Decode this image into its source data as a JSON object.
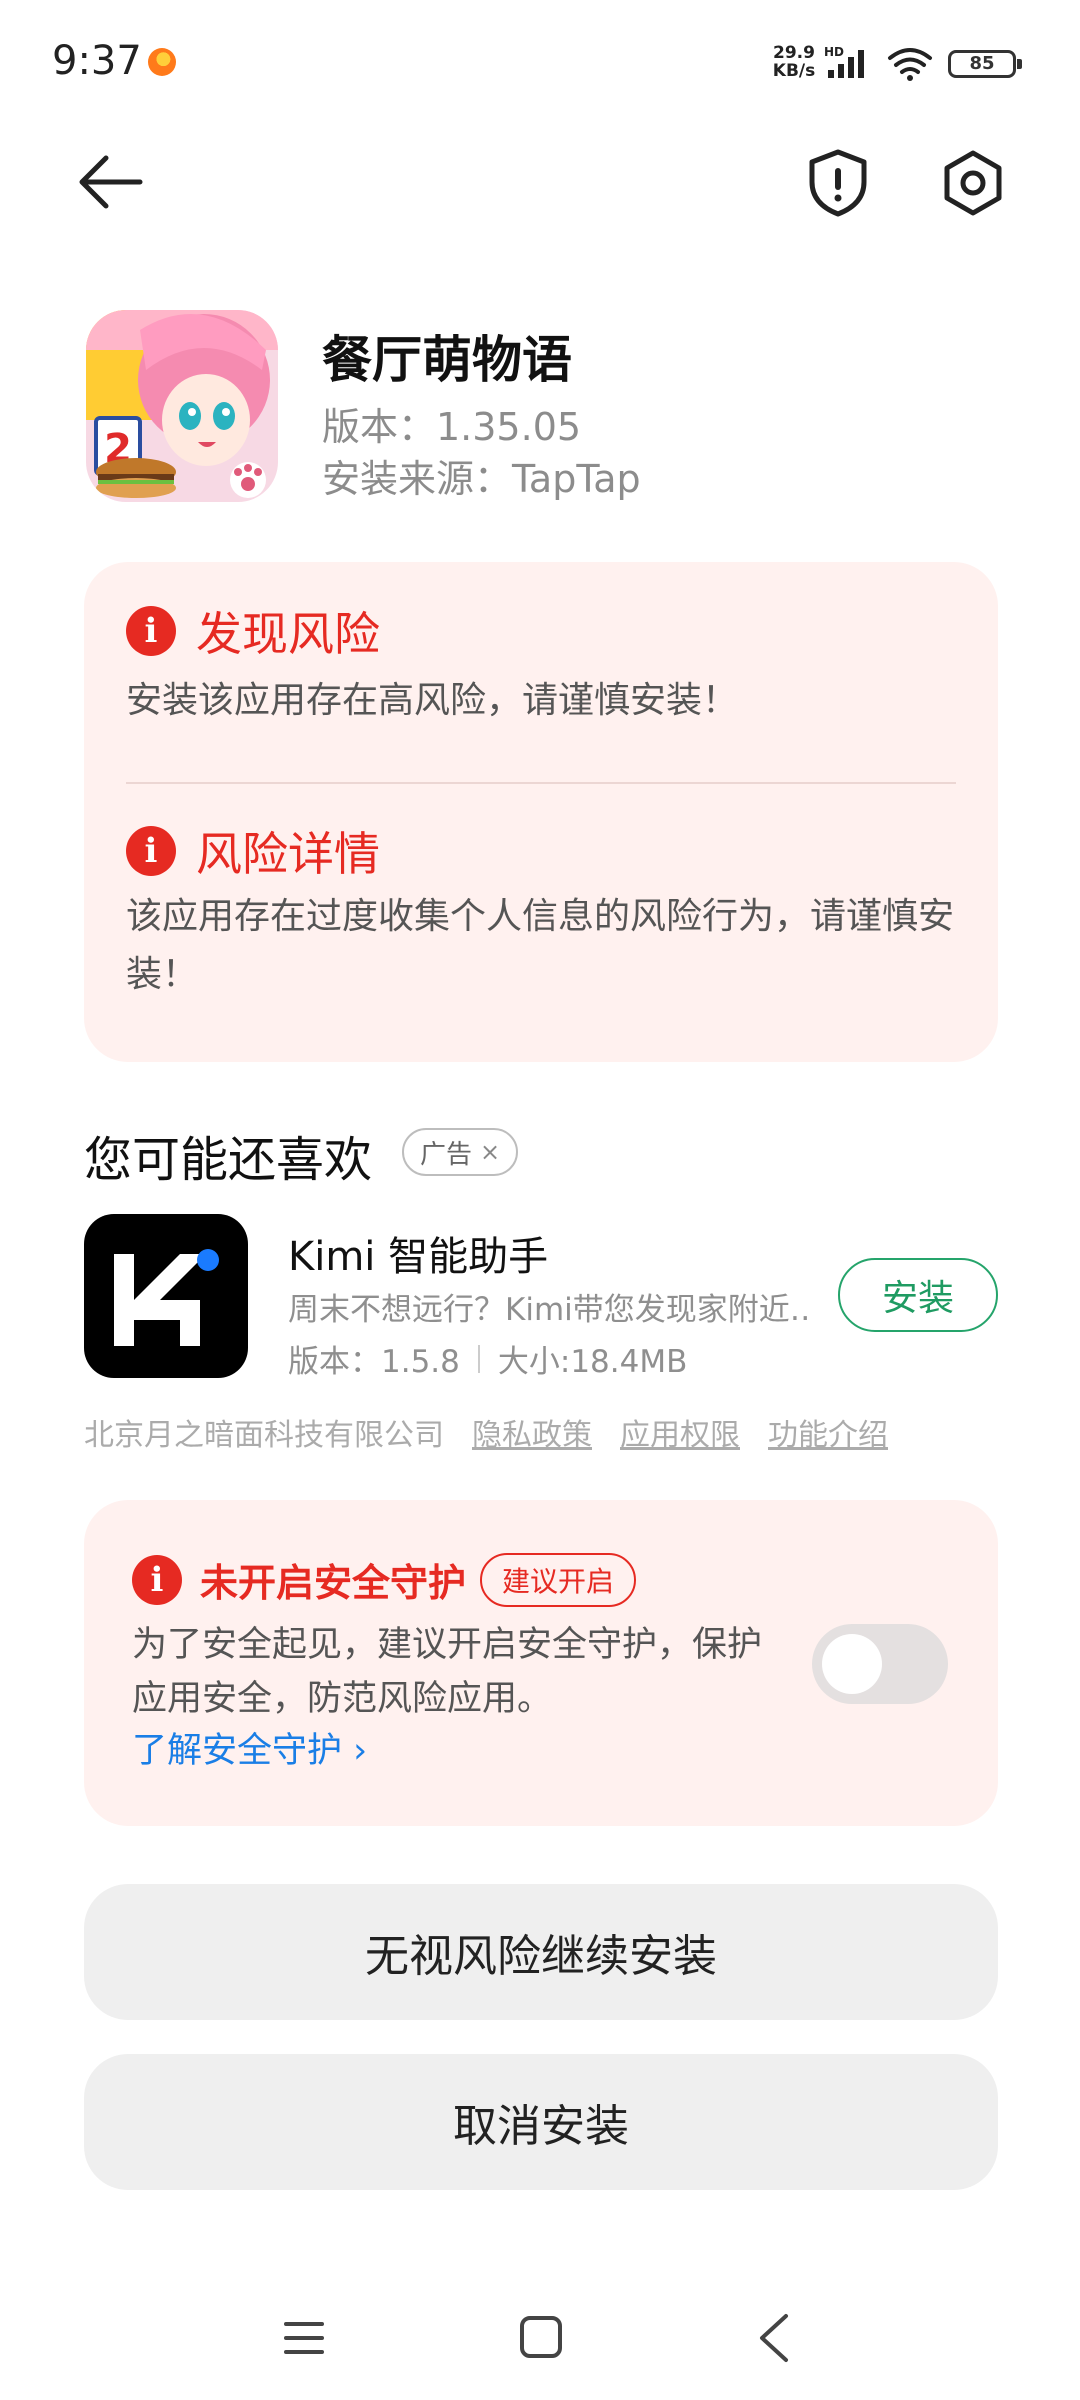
{
  "status_bar": {
    "time": "9:37",
    "net_speed_value": "29.9",
    "net_speed_unit": "KB/s",
    "signal_label": "HD",
    "battery": "85"
  },
  "app": {
    "name": "餐厅萌物语",
    "version": "版本：1.35.05",
    "source": "安装来源：TapTap",
    "icon_badge": "2"
  },
  "risk": {
    "found_title": "发现风险",
    "found_text": "安装该应用存在高风险，请谨慎安装！",
    "detail_title": "风险详情",
    "detail_text": "该应用存在过度收集个人信息的风险行为，请谨慎安装！",
    "accent_color": "#e62a22"
  },
  "recommend": {
    "title": "您可能还喜欢",
    "ad_label": "广告",
    "ad_close": "×",
    "app": {
      "name": "Kimi 智能助手",
      "desc": "周末不想远行？Kimi带您发现家附近…",
      "version": "版本：1.5.8",
      "size": "大小:18.4MB",
      "install_label": "安装"
    },
    "developer": "北京月之暗面科技有限公司",
    "links": [
      "隐私政策",
      "应用权限",
      "功能介绍"
    ]
  },
  "protection": {
    "title": "未开启安全守护",
    "badge": "建议开启",
    "text": "为了安全起见，建议开启安全守护，保护应用安全，防范风险应用。",
    "link": "了解安全守护 ›",
    "enabled": false
  },
  "actions": {
    "continue_label": "无视风险继续安装",
    "cancel_label": "取消安装"
  },
  "icons": {
    "back": "arrow-left-icon",
    "shield": "shield-icon",
    "settings": "gear-icon",
    "nav": [
      "menu-icon",
      "home-icon",
      "back-icon"
    ]
  }
}
